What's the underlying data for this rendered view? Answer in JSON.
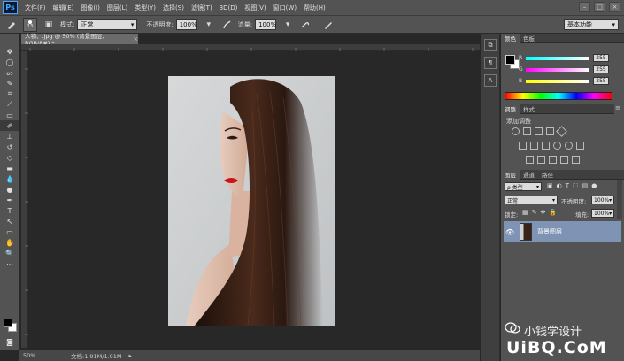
{
  "app": {
    "logo": "Ps",
    "menu": [
      "文件(F)",
      "编辑(E)",
      "图像(I)",
      "图层(L)",
      "类型(Y)",
      "选择(S)",
      "滤镜(T)",
      "3D(D)",
      "视图(V)",
      "窗口(W)",
      "帮助(H)"
    ],
    "window_buttons": [
      "–",
      "□",
      "×"
    ]
  },
  "options": {
    "brush_size": "13",
    "mode_label": "模式:",
    "mode_value": "正常",
    "opacity_label": "不透明度:",
    "opacity_value": "100%",
    "flow_label": "流量:",
    "flow_value": "100%",
    "workspace": "基本功能"
  },
  "document": {
    "tab_title": "人物、.jpg @ 50% (背景图层, RGB/8#) *",
    "close": "×",
    "zoom": "50%",
    "doc_info": "文档:1.91M/1.91M"
  },
  "color_panel": {
    "tabs": [
      "颜色",
      "色板"
    ],
    "r_label": "R",
    "g_label": "G",
    "b_label": "B",
    "r_value": "255",
    "g_value": "255",
    "b_value": "255"
  },
  "adjust_panel": {
    "tabs": [
      "调整",
      "样式"
    ],
    "title": "添加调整"
  },
  "layers_panel": {
    "tabs": [
      "图层",
      "通道",
      "路径"
    ],
    "filter_value": "ρ 类型",
    "blend_value": "正常",
    "opacity_label": "不透明度:",
    "opacity_value": "100%",
    "lock_label": "锁定:",
    "fill_label": "填充:",
    "fill_value": "100%",
    "layer_name": "背景图层"
  },
  "watermark": {
    "line1": "小钱学设计",
    "line2": "UiBQ.CoM"
  },
  "colors": {
    "chrome": "#535353",
    "canvas_bg": "#282828",
    "selected_layer": "#7f94b4",
    "ps_blue": "#4aa3ff"
  }
}
